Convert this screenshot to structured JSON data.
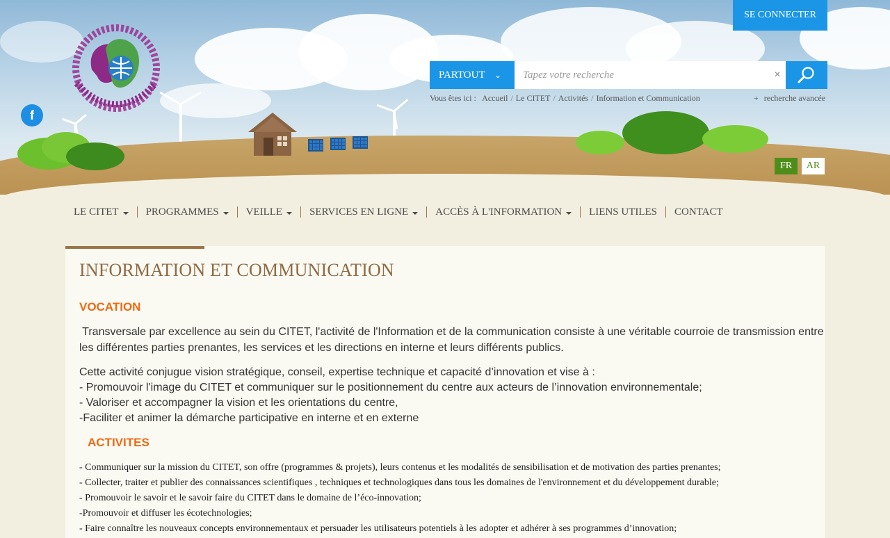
{
  "header": {
    "login_label": "SE CONNECTER",
    "search": {
      "scope_label": "PARTOUT",
      "placeholder": "Tapez votre recherche",
      "clear_label": "×"
    },
    "breadcrumb": {
      "prefix": "Vous êtes ici :",
      "items": [
        "Accueil",
        "Le CITET",
        "Activités",
        "Information et Communication"
      ],
      "separator": "/"
    },
    "advanced_search": {
      "plus": "+",
      "label": "recherche avancée"
    },
    "languages": [
      "FR",
      "AR"
    ],
    "active_language": "FR",
    "logo_alt": "Centre International des Technologies de l'Environnement de Tunis"
  },
  "nav": {
    "items": [
      {
        "label": "LE CITET",
        "dropdown": true
      },
      {
        "label": "PROGRAMMES",
        "dropdown": true
      },
      {
        "label": "VEILLE",
        "dropdown": true
      },
      {
        "label": "SERVICES EN LIGNE",
        "dropdown": true
      },
      {
        "label": "ACCÈS À L'INFORMATION",
        "dropdown": true
      },
      {
        "label": "LIENS UTILES",
        "dropdown": false
      },
      {
        "label": "CONTACT",
        "dropdown": false
      }
    ]
  },
  "content": {
    "title": "INFORMATION ET COMMUNICATION",
    "vocation_heading": "VOCATION",
    "vocation_p1_line1": " Transversale par excellence au sein du CITET, l'activité de l'Information et de la communication consiste à une véritable courroie de transmission entre",
    "vocation_p1_line2": "les différentes parties prenantes, les services et les directions en interne et leurs différents publics.",
    "vocation_p2": [
      "Cette activité conjugue vision stratégique, conseil, expertise technique et capacité d’innovation et vise à :",
      "- Promouvoir l'image du CITET et communiquer sur le positionnement du centre aux acteurs de l’innovation environnementale;",
      "- Valoriser et accompagner la vision et les orientations du centre,",
      "-Faciliter et animer la démarche participative en interne et en externe"
    ],
    "activites_heading": "ACTIVITES",
    "activites": [
      "- Communiquer sur la mission du CITET, son offre (programmes & projets), leurs contenus et les modalités de sensibilisation et de motivation des parties prenantes;",
      "- Collecter, traiter et publier des connaissances scientifiques , techniques et technologiques dans tous les domaines de l'environnement et du développement durable;",
      "- Promouvoir le savoir et le savoir faire du CITET dans le domaine de l’éco-innovation;",
      "-Promouvoir et diffuser les écotechnologies;",
      "- Faire connaître les nouveaux concepts environnementaux et persuader les utilisateurs potentiels à les adopter et adhérer à ses programmes d’innovation;"
    ]
  },
  "colors": {
    "accent_blue": "#1b96e6",
    "lang_green": "#4e8d1a",
    "title_brown": "#8e6b45",
    "heading_orange": "#ee6a12",
    "page_bg": "#f3efe0"
  },
  "icons": [
    "facebook-icon",
    "search-icon",
    "chevron-down-icon",
    "close-icon",
    "caret-down-icon"
  ]
}
